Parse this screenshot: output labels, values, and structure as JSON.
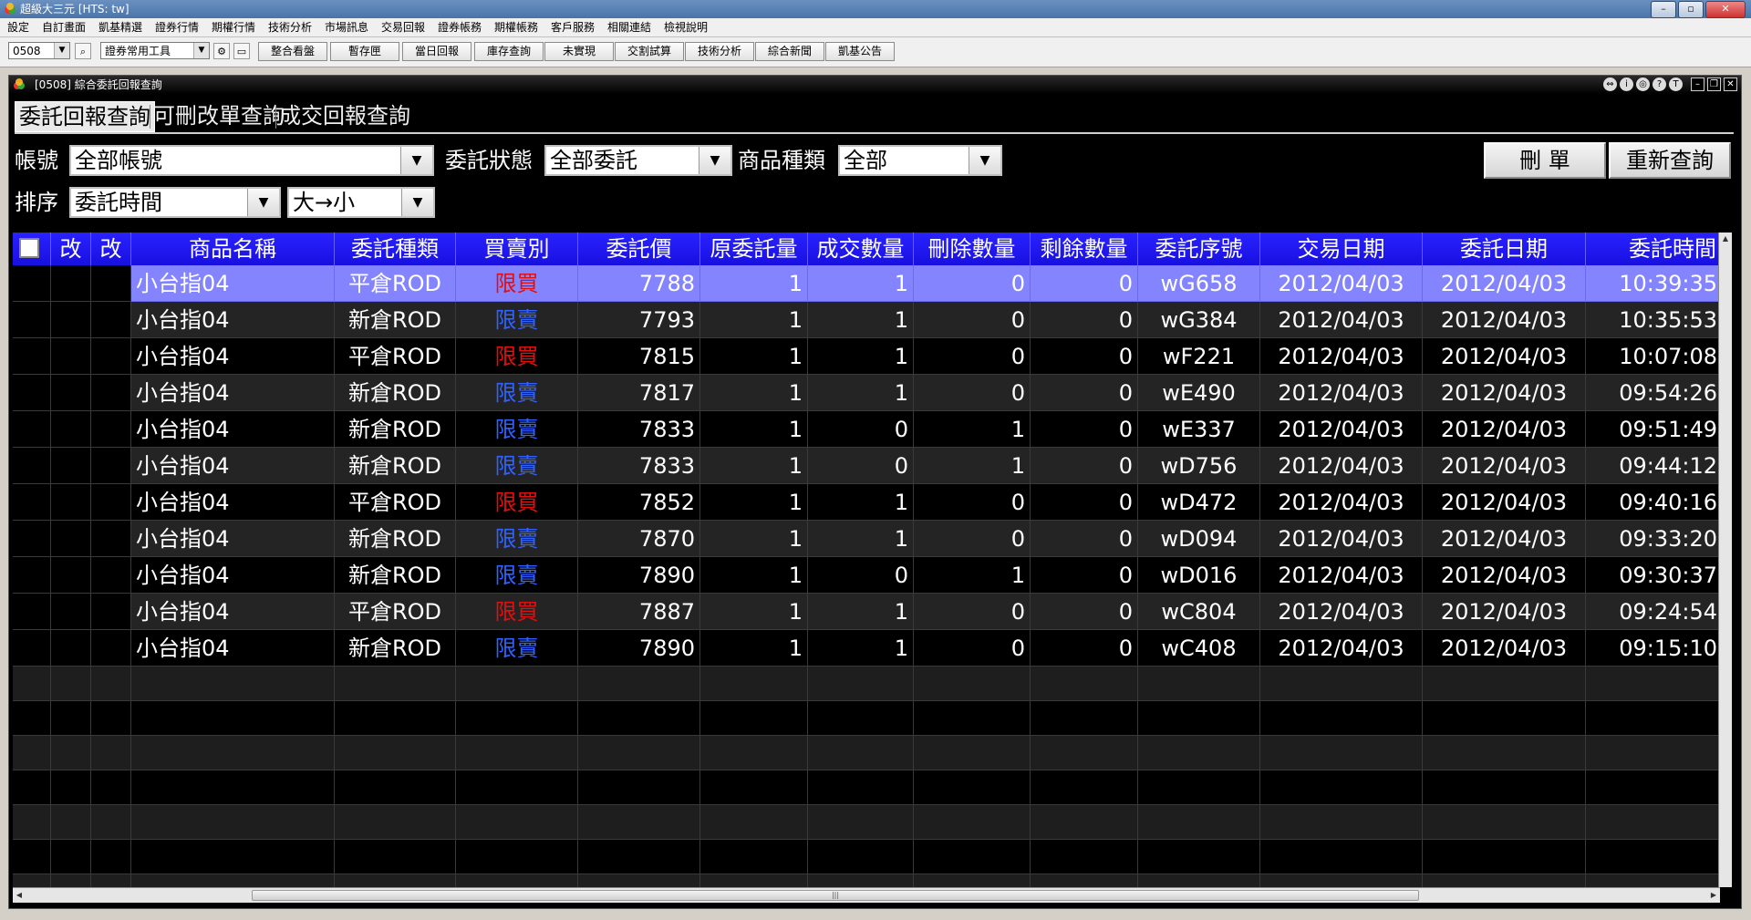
{
  "app": {
    "title": "超級大三元 [HTS: tw]",
    "menu": [
      "設定",
      "自訂畫面",
      "凱基精選",
      "證券行情",
      "期權行情",
      "技術分析",
      "市場訊息",
      "交易回報",
      "證券帳務",
      "期權帳務",
      "客戶服務",
      "相關連結",
      "檢視說明"
    ]
  },
  "toolbar": {
    "code": "0508",
    "toolset": "證券常用工具",
    "buttons": [
      "整合看盤",
      "暫存匣",
      "當日回報",
      "庫存查詢",
      "未實現",
      "交割試算",
      "技術分析",
      "綜合新聞",
      "凱基公告"
    ]
  },
  "window": {
    "title": "[0508] 綜合委託回報查詢",
    "tabs": [
      "委託回報查詢",
      "可刪改單查詢",
      "成交回報查詢"
    ],
    "icons": [
      "⇔",
      "i",
      "◎",
      "?",
      "T"
    ]
  },
  "filters": {
    "account_label": "帳號",
    "account_value": "全部帳號",
    "status_label": "委託狀態",
    "status_value": "全部委託",
    "product_label": "商品種類",
    "product_value": "全部",
    "sort_label": "排序",
    "sort_field": "委託時間",
    "sort_order": "大→小",
    "delete_button": "刪  單",
    "requery_button": "重新查詢"
  },
  "table": {
    "headers": [
      "改",
      "改",
      "商品名稱",
      "委託種類",
      "買賣別",
      "委託價",
      "原委託量",
      "成交數量",
      "刪除數量",
      "剩餘數量",
      "委託序號",
      "交易日期",
      "委託日期",
      "委託時間"
    ],
    "rows": [
      {
        "name": "小台指04",
        "type": "平倉ROD",
        "side": "限買",
        "price": "7788",
        "orig": "1",
        "filled": "1",
        "deleted": "0",
        "remain": "0",
        "seq": "wG658",
        "tdate": "2012/04/03",
        "odate": "2012/04/03",
        "time": "10:39:35"
      },
      {
        "name": "小台指04",
        "type": "新倉ROD",
        "side": "限賣",
        "price": "7793",
        "orig": "1",
        "filled": "1",
        "deleted": "0",
        "remain": "0",
        "seq": "wG384",
        "tdate": "2012/04/03",
        "odate": "2012/04/03",
        "time": "10:35:53"
      },
      {
        "name": "小台指04",
        "type": "平倉ROD",
        "side": "限買",
        "price": "7815",
        "orig": "1",
        "filled": "1",
        "deleted": "0",
        "remain": "0",
        "seq": "wF221",
        "tdate": "2012/04/03",
        "odate": "2012/04/03",
        "time": "10:07:08"
      },
      {
        "name": "小台指04",
        "type": "新倉ROD",
        "side": "限賣",
        "price": "7817",
        "orig": "1",
        "filled": "1",
        "deleted": "0",
        "remain": "0",
        "seq": "wE490",
        "tdate": "2012/04/03",
        "odate": "2012/04/03",
        "time": "09:54:26"
      },
      {
        "name": "小台指04",
        "type": "新倉ROD",
        "side": "限賣",
        "price": "7833",
        "orig": "1",
        "filled": "0",
        "deleted": "1",
        "remain": "0",
        "seq": "wE337",
        "tdate": "2012/04/03",
        "odate": "2012/04/03",
        "time": "09:51:49"
      },
      {
        "name": "小台指04",
        "type": "新倉ROD",
        "side": "限賣",
        "price": "7833",
        "orig": "1",
        "filled": "0",
        "deleted": "1",
        "remain": "0",
        "seq": "wD756",
        "tdate": "2012/04/03",
        "odate": "2012/04/03",
        "time": "09:44:12"
      },
      {
        "name": "小台指04",
        "type": "平倉ROD",
        "side": "限買",
        "price": "7852",
        "orig": "1",
        "filled": "1",
        "deleted": "0",
        "remain": "0",
        "seq": "wD472",
        "tdate": "2012/04/03",
        "odate": "2012/04/03",
        "time": "09:40:16"
      },
      {
        "name": "小台指04",
        "type": "新倉ROD",
        "side": "限賣",
        "price": "7870",
        "orig": "1",
        "filled": "1",
        "deleted": "0",
        "remain": "0",
        "seq": "wD094",
        "tdate": "2012/04/03",
        "odate": "2012/04/03",
        "time": "09:33:20"
      },
      {
        "name": "小台指04",
        "type": "新倉ROD",
        "side": "限賣",
        "price": "7890",
        "orig": "1",
        "filled": "0",
        "deleted": "1",
        "remain": "0",
        "seq": "wD016",
        "tdate": "2012/04/03",
        "odate": "2012/04/03",
        "time": "09:30:37"
      },
      {
        "name": "小台指04",
        "type": "平倉ROD",
        "side": "限買",
        "price": "7887",
        "orig": "1",
        "filled": "1",
        "deleted": "0",
        "remain": "0",
        "seq": "wC804",
        "tdate": "2012/04/03",
        "odate": "2012/04/03",
        "time": "09:24:54"
      },
      {
        "name": "小台指04",
        "type": "新倉ROD",
        "side": "限賣",
        "price": "7890",
        "orig": "1",
        "filled": "1",
        "deleted": "0",
        "remain": "0",
        "seq": "wC408",
        "tdate": "2012/04/03",
        "odate": "2012/04/03",
        "time": "09:15:10"
      }
    ]
  },
  "colors": {
    "header_bg": "#1810e0",
    "selected_row": "#8484ff",
    "buy": "#e01010",
    "sell": "#2f62ff"
  }
}
